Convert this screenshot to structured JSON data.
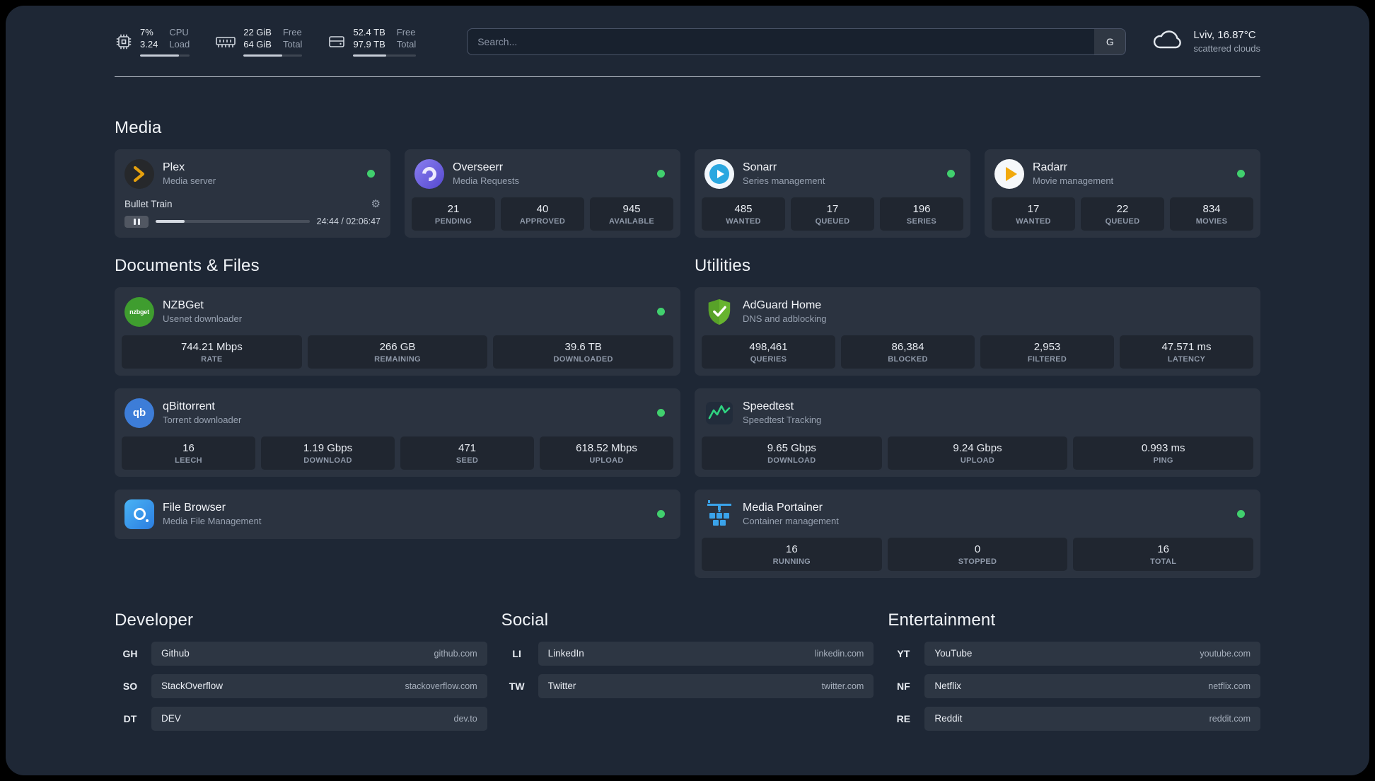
{
  "icons": {
    "settings_gear": "⚙"
  },
  "topbar": {
    "resources": [
      {
        "id": "cpu",
        "value_top": "7%",
        "value_bottom": "3.24",
        "label_top": "CPU",
        "label_bottom": "Load",
        "bar_percent": 78
      },
      {
        "id": "memory",
        "value_top": "22 GiB",
        "value_bottom": "64 GiB",
        "label_top": "Free",
        "label_bottom": "Total",
        "bar_percent": 66
      },
      {
        "id": "disk",
        "value_top": "52.4 TB",
        "value_bottom": "97.9 TB",
        "label_top": "Free",
        "label_bottom": "Total",
        "bar_percent": 53
      }
    ],
    "search": {
      "placeholder": "Search...",
      "provider_button": "G"
    },
    "weather": {
      "location": "Lviv, 16.87°C",
      "condition": "scattered clouds"
    }
  },
  "media": {
    "title": "Media",
    "plex": {
      "name": "Plex",
      "desc": "Media server",
      "player": {
        "track": "Bullet Train",
        "time": "24:44 / 02:06:47",
        "progress_percent": 19
      }
    },
    "overseerr": {
      "name": "Overseerr",
      "desc": "Media Requests",
      "stats": [
        {
          "value": "21",
          "label": "PENDING"
        },
        {
          "value": "40",
          "label": "APPROVED"
        },
        {
          "value": "945",
          "label": "AVAILABLE"
        }
      ]
    },
    "sonarr": {
      "name": "Sonarr",
      "desc": "Series management",
      "stats": [
        {
          "value": "485",
          "label": "WANTED"
        },
        {
          "value": "17",
          "label": "QUEUED"
        },
        {
          "value": "196",
          "label": "SERIES"
        }
      ]
    },
    "radarr": {
      "name": "Radarr",
      "desc": "Movie management",
      "stats": [
        {
          "value": "17",
          "label": "WANTED"
        },
        {
          "value": "22",
          "label": "QUEUED"
        },
        {
          "value": "834",
          "label": "MOVIES"
        }
      ]
    }
  },
  "documents": {
    "title": "Documents & Files",
    "nzbget": {
      "name": "NZBGet",
      "desc": "Usenet downloader",
      "logo_text": "nzbget",
      "stats": [
        {
          "value": "744.21 Mbps",
          "label": "RATE"
        },
        {
          "value": "266 GB",
          "label": "REMAINING"
        },
        {
          "value": "39.6 TB",
          "label": "DOWNLOADED"
        }
      ]
    },
    "qbittorrent": {
      "name": "qBittorrent",
      "desc": "Torrent downloader",
      "logo_text": "qb",
      "stats": [
        {
          "value": "16",
          "label": "LEECH"
        },
        {
          "value": "1.19 Gbps",
          "label": "DOWNLOAD"
        },
        {
          "value": "471",
          "label": "SEED"
        },
        {
          "value": "618.52 Mbps",
          "label": "UPLOAD"
        }
      ]
    },
    "filebrowser": {
      "name": "File Browser",
      "desc": "Media File Management"
    }
  },
  "utilities": {
    "title": "Utilities",
    "adguard": {
      "name": "AdGuard Home",
      "desc": "DNS and adblocking",
      "stats": [
        {
          "value": "498,461",
          "label": "QUERIES"
        },
        {
          "value": "86,384",
          "label": "BLOCKED"
        },
        {
          "value": "2,953",
          "label": "FILTERED"
        },
        {
          "value": "47.571 ms",
          "label": "LATENCY"
        }
      ]
    },
    "speedtest": {
      "name": "Speedtest",
      "desc": "Speedtest Tracking",
      "stats": [
        {
          "value": "9.65 Gbps",
          "label": "DOWNLOAD"
        },
        {
          "value": "9.24 Gbps",
          "label": "UPLOAD"
        },
        {
          "value": "0.993 ms",
          "label": "PING"
        }
      ]
    },
    "portainer": {
      "name": "Media Portainer",
      "desc": "Container management",
      "stats": [
        {
          "value": "16",
          "label": "RUNNING"
        },
        {
          "value": "0",
          "label": "STOPPED"
        },
        {
          "value": "16",
          "label": "TOTAL"
        }
      ]
    }
  },
  "bookmarks": {
    "groups": [
      {
        "title": "Developer",
        "items": [
          {
            "abbr": "GH",
            "name": "Github",
            "url": "github.com"
          },
          {
            "abbr": "SO",
            "name": "StackOverflow",
            "url": "stackoverflow.com"
          },
          {
            "abbr": "DT",
            "name": "DEV",
            "url": "dev.to"
          }
        ]
      },
      {
        "title": "Social",
        "items": [
          {
            "abbr": "LI",
            "name": "LinkedIn",
            "url": "linkedin.com"
          },
          {
            "abbr": "TW",
            "name": "Twitter",
            "url": "twitter.com"
          }
        ]
      },
      {
        "title": "Entertainment",
        "items": [
          {
            "abbr": "YT",
            "name": "YouTube",
            "url": "youtube.com"
          },
          {
            "abbr": "NF",
            "name": "Netflix",
            "url": "netflix.com"
          },
          {
            "abbr": "RE",
            "name": "Reddit",
            "url": "reddit.com"
          }
        ]
      }
    ]
  }
}
